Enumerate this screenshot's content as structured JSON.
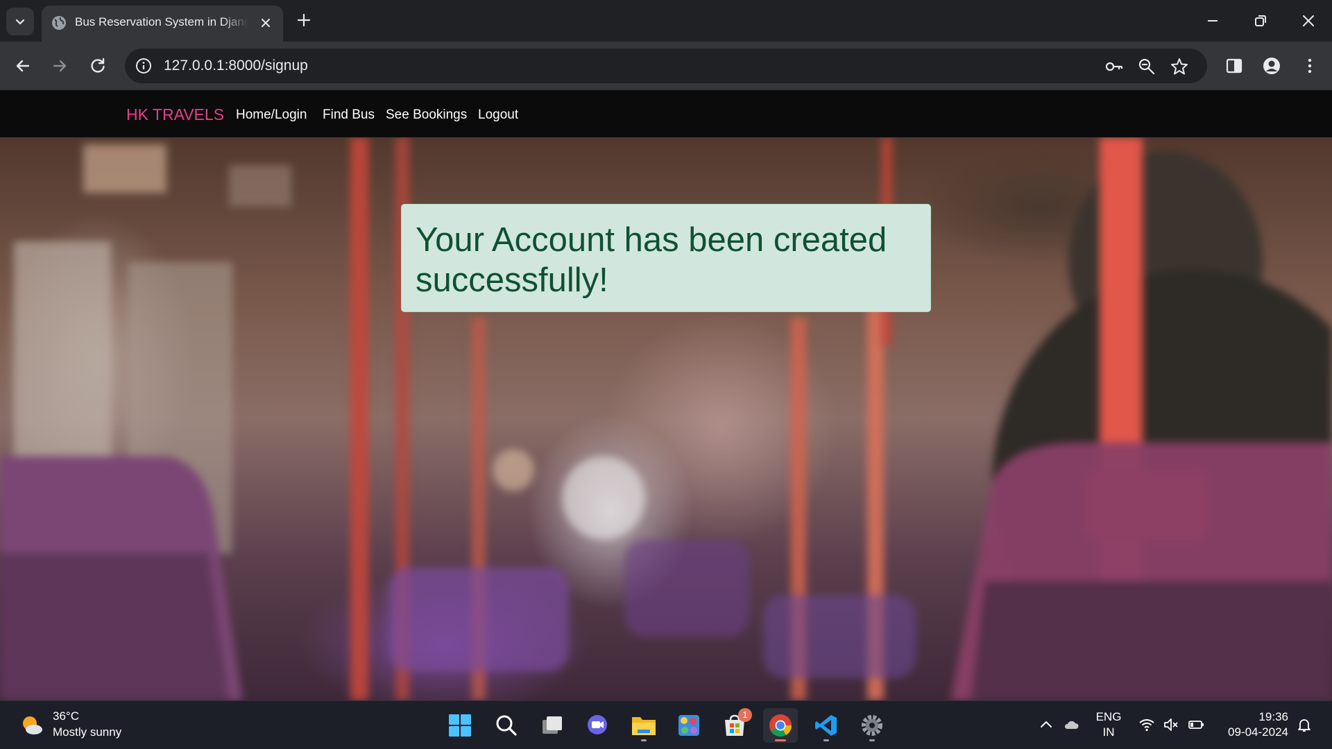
{
  "browser": {
    "tab_title": "Bus Reservation System in Django",
    "url": "127.0.0.1:8000/signup"
  },
  "site": {
    "brand": "HK TRAVELS",
    "nav": [
      {
        "label": "Home/Login"
      },
      {
        "label": "Find Bus"
      },
      {
        "label": "See Bookings"
      },
      {
        "label": "Logout"
      }
    ],
    "alert_message": "Your Account has been created successfully!"
  },
  "taskbar": {
    "weather": {
      "temp": "36°C",
      "condition": "Mostly sunny",
      "icon": "partly-sunny-icon"
    },
    "apps": [
      {
        "name": "start-icon"
      },
      {
        "name": "search-icon"
      },
      {
        "name": "task-view-icon"
      },
      {
        "name": "teams-chat-icon"
      },
      {
        "name": "file-explorer-icon"
      },
      {
        "name": "photo-app-icon"
      },
      {
        "name": "microsoft-store-icon",
        "badge": "1"
      },
      {
        "name": "chrome-icon",
        "active": true
      },
      {
        "name": "vscode-icon"
      },
      {
        "name": "settings-icon"
      }
    ],
    "language": {
      "line1": "ENG",
      "line2": "IN"
    },
    "time": "19:36",
    "date": "09-04-2024"
  },
  "colors": {
    "brand": "#e83e8c",
    "alert_bg": "#d1e7dd",
    "alert_text": "#0f5132",
    "navbar_bg": "#0b0b0b"
  }
}
